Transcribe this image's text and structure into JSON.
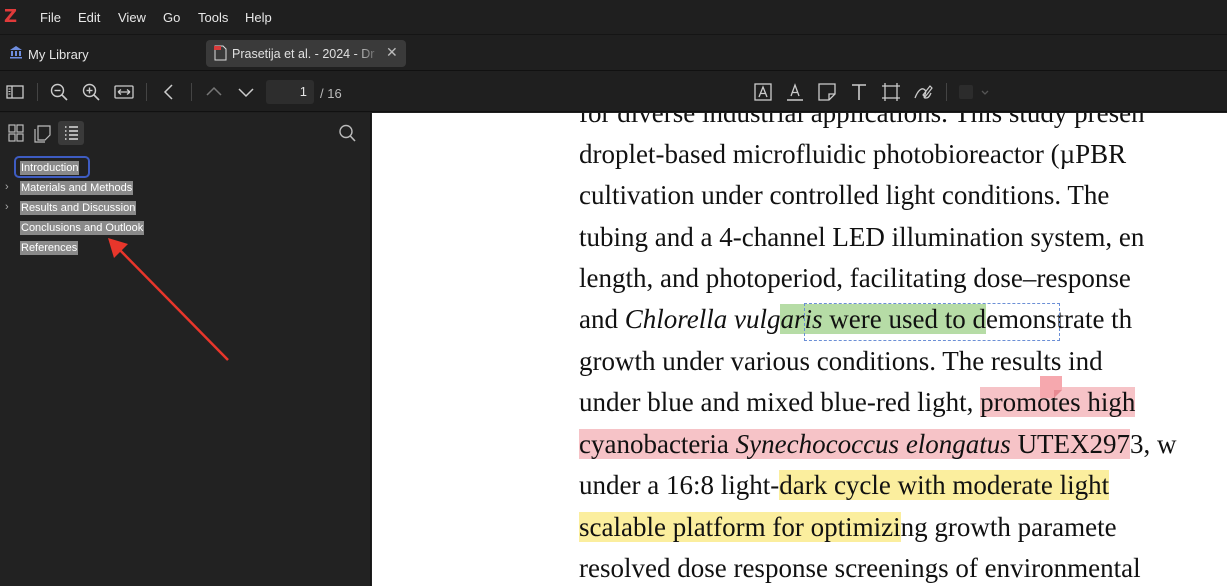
{
  "app": {
    "logo": "Z",
    "menu": [
      "File",
      "Edit",
      "View",
      "Go",
      "Tools",
      "Help"
    ]
  },
  "tabs": {
    "library_label": "My Library",
    "library_icon": "library-icon",
    "document_label": "Prasetija et al. - 2024 - Dr",
    "document_icon": "pdf-icon",
    "close_icon": "close-icon"
  },
  "toolbar": {
    "page_current": "1",
    "page_total": "/ 16",
    "left_icons": [
      "sidebar-toggle-icon",
      "zoom-out-icon",
      "zoom-in-icon",
      "fit-width-icon",
      "back-icon",
      "previous-page-icon",
      "next-page-icon"
    ],
    "annotation_icons": [
      "highlight-text-icon",
      "underline-text-icon",
      "note-icon",
      "text-icon",
      "area-select-icon",
      "ink-draw-icon",
      "color-picker-icon"
    ]
  },
  "sidebar": {
    "view_icons": [
      "thumbnails-icon",
      "annotations-icon",
      "outline-icon"
    ],
    "active_view": "outline-icon",
    "search_icon": "search-icon",
    "outline": [
      {
        "label": "Introduction",
        "expandable": false,
        "focused": true
      },
      {
        "label": "Materials and Methods",
        "expandable": true,
        "focused": false
      },
      {
        "label": "Results and Discussion",
        "expandable": true,
        "focused": false
      },
      {
        "label": "Conclusions and Outlook",
        "expandable": false,
        "focused": false
      },
      {
        "label": "References",
        "expandable": false,
        "focused": false
      }
    ]
  },
  "document": {
    "lines": [
      {
        "text": "for diverse industrial applications. This study presen"
      },
      {
        "text": "droplet-based microfluidic photobioreactor (µPBR"
      },
      {
        "text": "cultivation under controlled light conditions. The"
      },
      {
        "text": "tubing and a 4-channel LED illumination system, en"
      },
      {
        "text": "length, and photoperiod, facilitating dose–response"
      },
      {
        "a": "and ",
        "b": "Chlorella vulg",
        "c": "aris",
        "d": " were used to d",
        "e": "emonstrate th"
      },
      {
        "text": "growth under various conditions. The results ind"
      },
      {
        "a": "under blue and mixed blue-red light, ",
        "b": "promotes high"
      },
      {
        "a": "cyanobacteria ",
        "b": "Synechococcus elongatus",
        "c": " UTEX297",
        "d": "3, w"
      },
      {
        "a": "under a 16:8 light-",
        "b": "dark cycle with moderate light"
      },
      {
        "a": "scalable platform for optimizi",
        "b": "ng growth paramete"
      },
      {
        "text": "resolved dose response screenings of environmental"
      }
    ],
    "highlight_colors": {
      "green": "#b6dca6",
      "pink": "#f6c3c7",
      "yellow": "#fbee9e"
    },
    "selection_color": "#6b8fd6"
  },
  "annotation_arrow_color": "#e8362b"
}
